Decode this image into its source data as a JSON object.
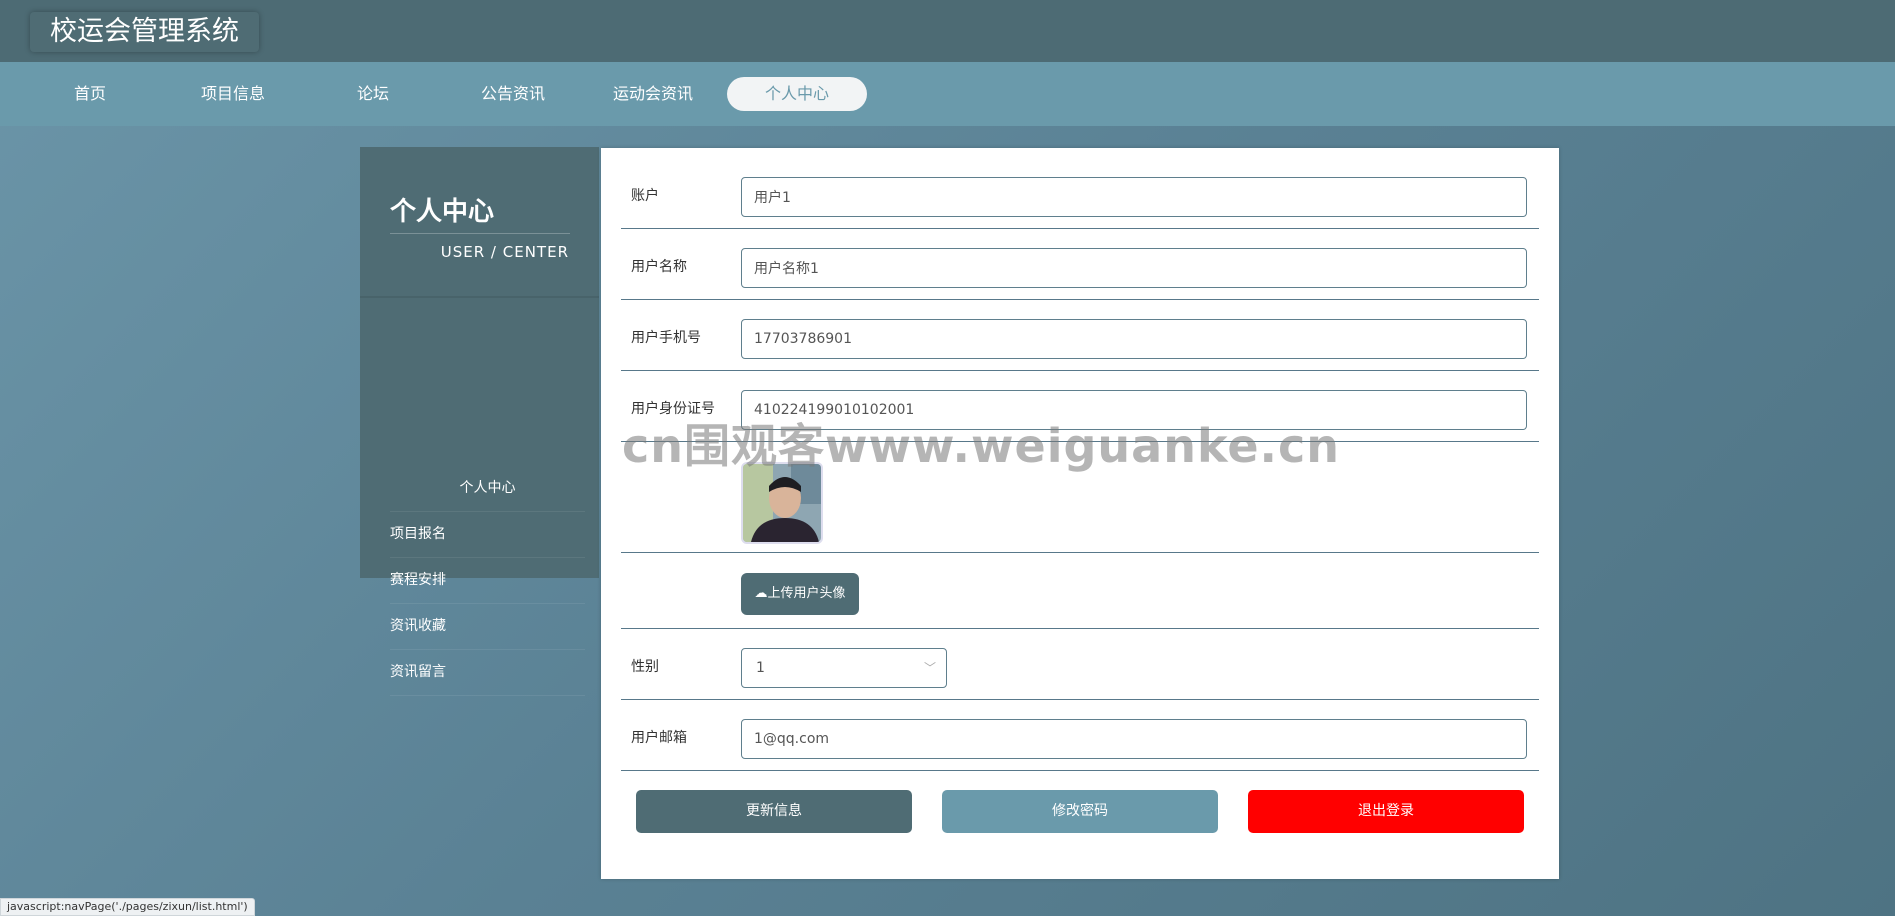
{
  "app": {
    "title": "校运会管理系统"
  },
  "nav": {
    "items": [
      {
        "label": "首页"
      },
      {
        "label": "项目信息"
      },
      {
        "label": "论坛"
      },
      {
        "label": "公告资讯"
      },
      {
        "label": "运动会资讯"
      },
      {
        "label": "个人中心"
      }
    ],
    "active": "个人中心"
  },
  "sidebar": {
    "title": "个人中心",
    "subtitle": "USER / CENTER",
    "items": [
      {
        "label": "个人中心"
      },
      {
        "label": "项目报名"
      },
      {
        "label": "赛程安排"
      },
      {
        "label": "资讯收藏"
      },
      {
        "label": "资讯留言"
      }
    ]
  },
  "form": {
    "account": {
      "label": "账户",
      "value": "用户1"
    },
    "username": {
      "label": "用户名称",
      "value": "用户名称1"
    },
    "phone": {
      "label": "用户手机号",
      "value": "17703786901"
    },
    "idcard": {
      "label": "用户身份证号",
      "value": "410224199010102001"
    },
    "avatar": {
      "alt": "用户头像"
    },
    "upload_label": "上传用户头像",
    "upload_icon": "cloud-upload-icon",
    "gender": {
      "label": "性别",
      "value": "1"
    },
    "email": {
      "label": "用户邮箱",
      "value": "1@qq.com"
    }
  },
  "buttons": {
    "update": "更新信息",
    "password": "修改密码",
    "logout": "退出登录"
  },
  "colors": {
    "primary": "#4f6c74",
    "secondary": "#6a9aab",
    "danger": "#ff0000"
  },
  "watermark": "cn围观客www.weiguanke.cn",
  "status_url": "javascript:navPage('./pages/zixun/list.html')"
}
